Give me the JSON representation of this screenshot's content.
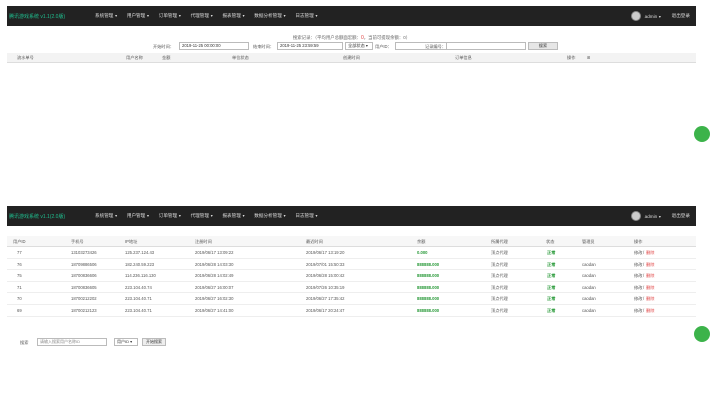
{
  "navbar": {
    "brand": "腾讯游戏系统 v1.1(2.0版)",
    "items": [
      {
        "label": "系统管理"
      },
      {
        "label": "用户管理"
      },
      {
        "label": "订单管理"
      },
      {
        "label": "代理管理"
      },
      {
        "label": "报表管理"
      },
      {
        "label": "数据分析管理"
      },
      {
        "label": "日志管理"
      }
    ],
    "user": "admin",
    "logout": "退出登录"
  },
  "panel_a": {
    "stats_prefix": "搜索记录：（平均用户总额面宏额：",
    "stats_red": "0",
    "stats_suffix": "，当前可提现余额：0）",
    "filters": {
      "start_label": "开始时间：",
      "start_value": "2019-11-25 00:00:00",
      "end_label": "结束时间：",
      "end_value": "2019-11-25 23:59:59",
      "status_select": "全部状态",
      "user_label": "用户ID：",
      "rec_label": "记录编号：",
      "search_button": "搜索"
    },
    "columns": [
      "流水单号",
      "用户名称",
      "金额",
      "单位状态",
      "创建时间",
      "订单信息",
      "操作"
    ]
  },
  "table_b": {
    "columns": [
      "用户ID",
      "手机号",
      "IP地址",
      "注册时间",
      "最近时间",
      "余额",
      "所属代理",
      "状态",
      "管理员",
      "操作"
    ],
    "rows": [
      {
        "id": "77",
        "phone": "13103273426",
        "ip": "125.237.124.43",
        "reg": "2019/06/17 13:09:22",
        "last": "2019/06/17 13:19:20",
        "amount": "0.000",
        "agent": "顶点代理",
        "status": "正常",
        "admin": "",
        "edit": "修改",
        "del": "删除"
      },
      {
        "id": "76",
        "phone": "18709886506",
        "ip": "182.240.59.223",
        "reg": "2019/06/28 14:03:30",
        "last": "2019/07/01 15:50:33",
        "amount": "888888.000",
        "agent": "顶点代理",
        "status": "正常",
        "admin": "caodan",
        "edit": "修改",
        "del": "删除"
      },
      {
        "id": "75",
        "phone": "18700836606",
        "ip": "114.236.116.130",
        "reg": "2019/06/28 14:02:49",
        "last": "2019/06/28 15:00:42",
        "amount": "888888.000",
        "agent": "顶点代理",
        "status": "正常",
        "admin": "caodan",
        "edit": "修改",
        "del": "删除"
      },
      {
        "id": "71",
        "phone": "18700836605",
        "ip": "223.104.40.74",
        "reg": "2019/06/27 16:00:07",
        "last": "2019/07/26 10:35:19",
        "amount": "888888.000",
        "agent": "顶点代理",
        "status": "正常",
        "admin": "caodan",
        "edit": "修改",
        "del": "删除"
      },
      {
        "id": "70",
        "phone": "18700212202",
        "ip": "223.104.40.71",
        "reg": "2019/06/27 16:02:30",
        "last": "2019/06/27 17:35:42",
        "amount": "888888.000",
        "agent": "顶点代理",
        "status": "正常",
        "admin": "caodan",
        "edit": "修改",
        "del": "删除"
      },
      {
        "id": "69",
        "phone": "18700212123",
        "ip": "223.104.40.71",
        "reg": "2019/06/27 14:41:00",
        "last": "2019/06/17 20:24:47",
        "amount": "888888.000",
        "agent": "顶点代理",
        "status": "正常",
        "admin": "caodan",
        "edit": "修改",
        "del": "删除"
      }
    ]
  },
  "pager": {
    "label": "搜索",
    "input_placeholder": "请输入搜索用户名称ID",
    "select": "用户ID",
    "button": "开始搜索"
  },
  "colors": {
    "navbar": "#222222",
    "brand": "#1fbf8f",
    "green": "#2a9a3a",
    "red": "#e04040",
    "fab": "#3cb34a"
  }
}
